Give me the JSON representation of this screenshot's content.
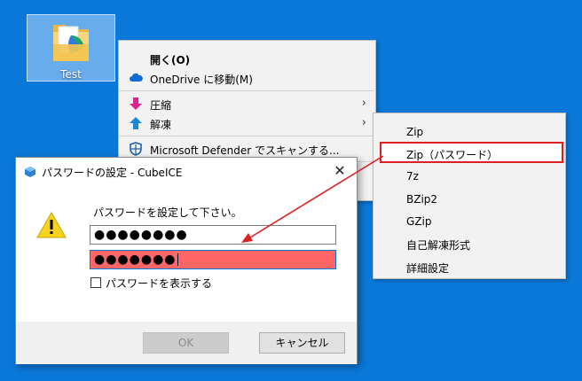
{
  "desktop": {
    "folder_label": "Test"
  },
  "context_menu": {
    "items": [
      {
        "label": "開く(O)",
        "icon": ""
      },
      {
        "label": "OneDrive に移動(M)",
        "icon": "onedrive-cloud-icon"
      },
      {
        "label": "圧縮",
        "icon": "compress-arrow-down-icon",
        "submenu": true
      },
      {
        "label": "解凍",
        "icon": "extract-arrow-up-icon",
        "submenu": true
      },
      {
        "label": "Microsoft Defender でスキャンする...",
        "icon": "defender-shield-icon"
      }
    ],
    "submenu_arrow": "›"
  },
  "submenu": {
    "items": [
      "Zip",
      "Zip（パスワード）",
      "7z",
      "BZip2",
      "GZip",
      "自己解凍形式",
      "詳細設定"
    ],
    "highlighted_index": 1,
    "highlight_color": "#e02020"
  },
  "dialog": {
    "title": "パスワードの設定 - CubeICE",
    "close_glyph": "✕",
    "prompt": "パスワードを設定して下さい。",
    "password_masked": "●●●●●●●●",
    "confirm_masked": "●●●●●●●",
    "confirm_error_color": "#ff6666",
    "show_password_label": "パスワードを表示する",
    "show_password_checked": false,
    "ok_label": "OK",
    "ok_enabled": false,
    "cancel_label": "キャンセル"
  },
  "colors": {
    "desktop_bg": "#0a78d8",
    "annotation_red": "#e02020"
  }
}
